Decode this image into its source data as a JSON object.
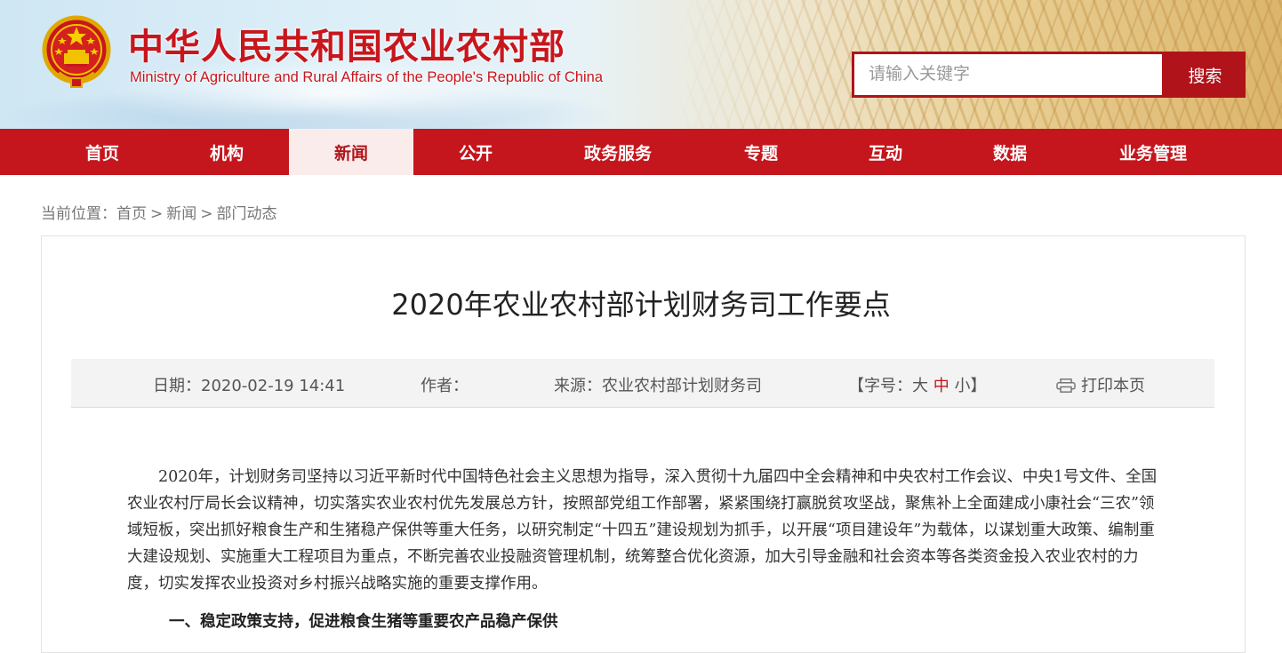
{
  "header": {
    "site_title": "中华人民共和国农业农村部",
    "site_subtitle": "Ministry of Agriculture and Rural Affairs of the People's Republic of China",
    "emblem_icon": "national-emblem-icon",
    "search": {
      "placeholder": "请输入关键字",
      "value": "",
      "button_label": "搜索"
    }
  },
  "nav": {
    "items": [
      {
        "label": "首页"
      },
      {
        "label": "机构"
      },
      {
        "label": "新闻",
        "active": true
      },
      {
        "label": "公开"
      },
      {
        "label": "政务服务"
      },
      {
        "label": "专题"
      },
      {
        "label": "互动"
      },
      {
        "label": "数据"
      },
      {
        "label": "业务管理"
      }
    ]
  },
  "breadcrumb": {
    "prefix": "当前位置：",
    "items": [
      "首页",
      "新闻",
      "部门动态"
    ],
    "separator": ">"
  },
  "article": {
    "title": "2020年农业农村部计划财务司工作要点",
    "meta": {
      "date_label": "日期：",
      "date": "2020-02-19 14:41",
      "author_label": "作者：",
      "author": "",
      "source_label": "来源：",
      "source": "农业农村部计划财务司",
      "font_size_prefix": "【字号：",
      "font_size_big": "大",
      "font_size_mid": "中",
      "font_size_small": "小",
      "font_size_suffix": "】",
      "print_label": "打印本页",
      "print_icon": "printer-icon"
    },
    "paragraph_1": "2020年，计划财务司坚持以习近平新时代中国特色社会主义思想为指导，深入贯彻十九届四中全会精神和中央农村工作会议、中央1号文件、全国农业农村厅局长会议精神，切实落实农业农村优先发展总方针，按照部党组工作部署，紧紧围绕打赢脱贫攻坚战，聚焦补上全面建成小康社会“三农”领域短板，突出抓好粮食生产和生猪稳产保供等重大任务，以研究制定“十四五”建设规划为抓手，以开展“项目建设年”为载体，以谋划重大政策、编制重大建设规划、实施重大工程项目为重点，不断完善农业投融资管理机制，统筹整合优化资源，加大引导金融和社会资本等各类资金投入农业农村的力度，切实发挥农业投资对乡村振兴战略实施的重要支撑作用。",
    "section_1_heading": "一、稳定政策支持，促进粮食生猪等重要农产品稳产保供"
  },
  "colors": {
    "brand_red": "#c5161d",
    "nav_active_bg": "#fbecec",
    "text": "#333333",
    "muted": "#777777"
  }
}
